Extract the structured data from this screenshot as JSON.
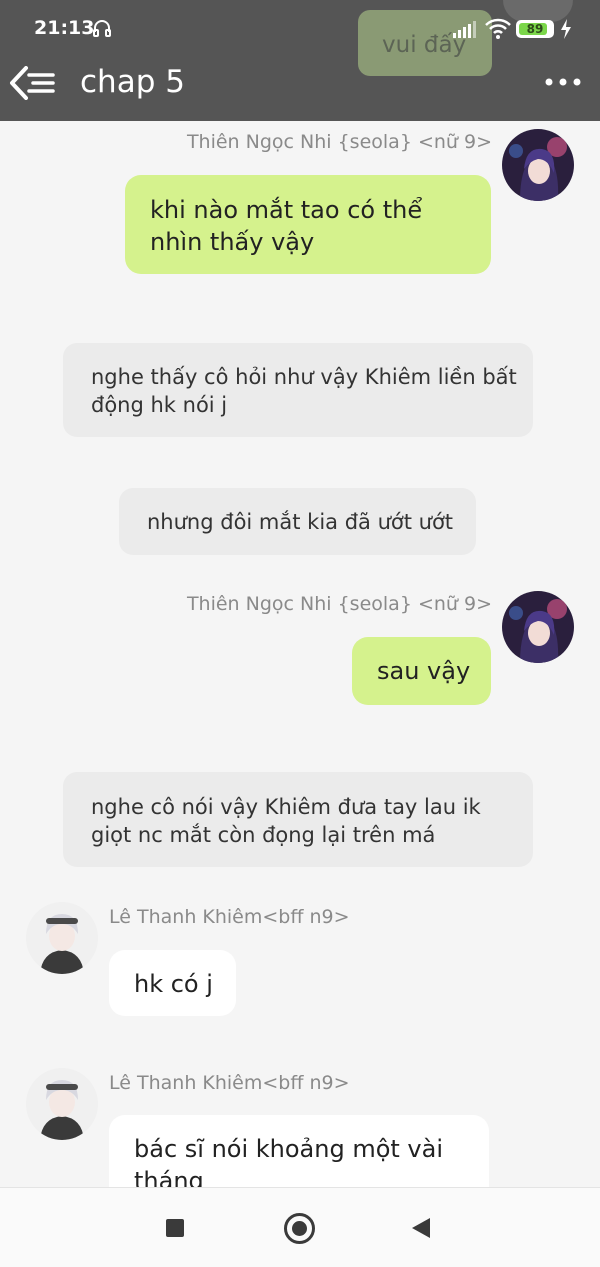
{
  "status_bar": {
    "time": "21:13",
    "battery": "89",
    "battery_level": 0.89
  },
  "header": {
    "title": "chap 5",
    "prev_message": "vui đấy"
  },
  "colors": {
    "header_bg": "#555555",
    "sender_bubble": "#d5f28d",
    "receiver_bubble": "#ffffff",
    "narration_bg": "#ebebeb",
    "page_bg": "#f5f5f5"
  },
  "messages": [
    {
      "type": "sent",
      "sender": "Thiên Ngọc Nhi {seola} <nữ 9>",
      "text_lines": [
        "khi nào mắt tao có thể",
        "nhìn thấy vậy"
      ]
    },
    {
      "type": "narration",
      "text_lines": [
        "nghe thấy cô hỏi như vậy Khiêm liền bất",
        "động hk nói j"
      ]
    },
    {
      "type": "narration",
      "text_lines": [
        "nhưng đôi mắt kia đã ướt ướt"
      ]
    },
    {
      "type": "sent",
      "sender": "Thiên Ngọc Nhi {seola} <nữ 9>",
      "text_lines": [
        "sau vậy"
      ]
    },
    {
      "type": "narration",
      "text_lines": [
        "nghe cô nói vậy Khiêm đưa tay lau ik",
        "giọt nc mắt còn đọng lại trên má"
      ]
    },
    {
      "type": "received",
      "sender": "Lê Thanh Khiêm<bff n9>",
      "text_lines": [
        "hk có j"
      ]
    },
    {
      "type": "received",
      "sender": "Lê Thanh Khiêm<bff n9>",
      "text_lines": [
        "bác sĩ nói khoảng một vài",
        "tháng"
      ]
    }
  ]
}
